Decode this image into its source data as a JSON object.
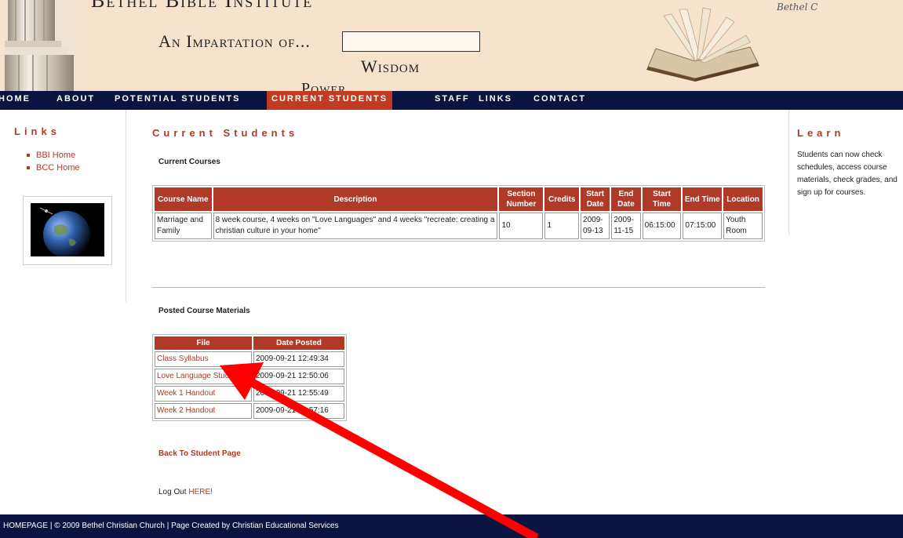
{
  "header": {
    "site_title": "Bethel Bible Institute",
    "tagline": "An Impartation of...",
    "word_wisdom": "Wisdom",
    "word_power": "Power",
    "book_script": "Bethel C"
  },
  "nav": {
    "items": [
      "HOME",
      "ABOUT",
      "POTENTIAL STUDENTS",
      "CURRENT STUDENTS",
      "STAFF",
      "LINKS",
      "CONTACT"
    ],
    "active_index": 3
  },
  "left_sidebar": {
    "title": "Links",
    "links": [
      "BBI Home",
      "BCC Home"
    ]
  },
  "main": {
    "title": "Current Students",
    "courses_heading": "Current Courses",
    "courses_table": {
      "headers": [
        "Course Name",
        "Description",
        "Section Number",
        "Credits",
        "Start Date",
        "End Date",
        "Start Time",
        "End Time",
        "Location"
      ],
      "rows": [
        [
          "Marriage and Family",
          "8 week course, 4 weeks on \"Love Languages\" and 4 weeks \"recreate: creating a christian culture in your home\"",
          "10",
          "1",
          "2009-09-13",
          "2009-11-15",
          "06:15:00",
          "07:15:00",
          "Youth Room"
        ]
      ]
    },
    "materials_heading": "Posted Course Materials",
    "materials_table": {
      "headers": [
        "File",
        "Date Posted"
      ],
      "rows": [
        [
          "Class Syllabus",
          "2009-09-21 12:49:34"
        ],
        [
          "Love Language Study",
          "2009-09-21 12:50:06"
        ],
        [
          "Week 1 Handout",
          "2009-09-21 12:55:49"
        ],
        [
          "Week 2 Handout",
          "2009-09-21 12:57:16"
        ]
      ]
    },
    "back_link": "Back To Student Page",
    "logout_prefix": "Log Out ",
    "logout_link": "HERE!"
  },
  "right_sidebar": {
    "title": "Learn",
    "text": "Students can now check schedules, access course materials, check grades, and sign up for courses."
  },
  "footer": {
    "text": "HOMEPAGE | © 2009 Bethel Christian Church | Page Created by Christian Educational Services"
  },
  "annotation": {
    "arrow_color": "#ff0000",
    "arrow_target": "Class Syllabus"
  },
  "colors": {
    "accent": "#b03a26",
    "nav_bg": "#0b1440",
    "nav_active": "#c13b22",
    "header_bg": "#f7e2cc"
  }
}
